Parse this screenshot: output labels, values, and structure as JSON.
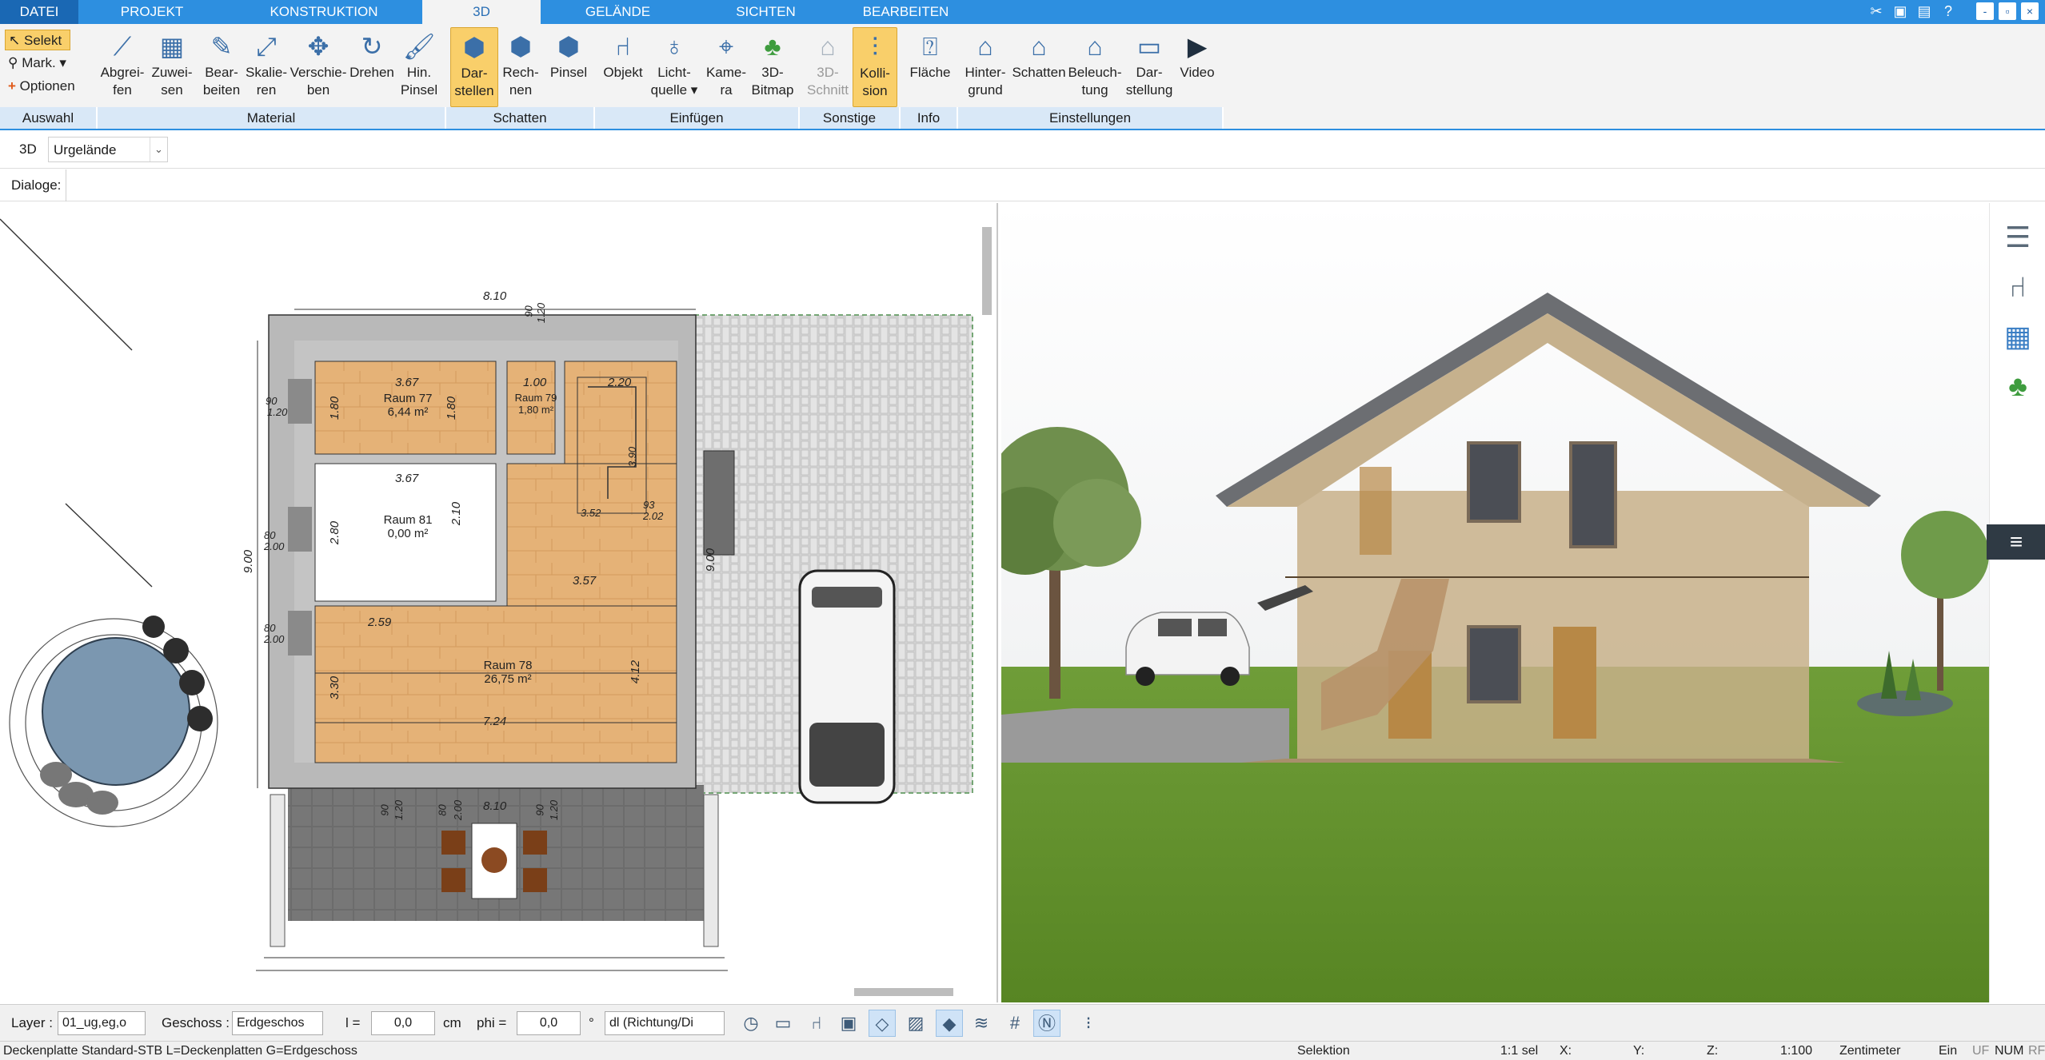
{
  "tabs": {
    "file": "DATEI",
    "items": [
      "PROJEKT",
      "KONSTRUKTION",
      "3D",
      "GELÄNDE",
      "SICHTEN",
      "BEARBEITEN"
    ],
    "active": "3D"
  },
  "window_controls": {
    "minimize": "-",
    "restore": "▫",
    "close": "×"
  },
  "ribbon": {
    "auswahl": {
      "select": "Selekt",
      "mark": "Mark.",
      "options": "Optionen",
      "group": "Auswahl"
    },
    "material": {
      "group": "Material",
      "buttons": [
        {
          "l1": "Abgrei-",
          "l2": "fen",
          "icon": "eyedropper-icon"
        },
        {
          "l1": "Zuwei-",
          "l2": "sen",
          "icon": "assign-icon"
        },
        {
          "l1": "Bear-",
          "l2": "beiten",
          "icon": "edit-material-icon"
        },
        {
          "l1": "Skalie-",
          "l2": "ren",
          "icon": "scale-icon"
        },
        {
          "l1": "Verschie-",
          "l2": "ben",
          "icon": "move-icon"
        },
        {
          "l1": "Drehen",
          "l2": "",
          "icon": "rotate-icon"
        },
        {
          "l1": "Hin.",
          "l2": "Pinsel",
          "icon": "brush-icon"
        }
      ]
    },
    "schatten": {
      "group": "Schatten",
      "buttons": [
        {
          "l1": "Dar-",
          "l2": "stellen",
          "icon": "shadow-display-icon",
          "active": true
        },
        {
          "l1": "Rech-",
          "l2": "nen",
          "icon": "shadow-calc-icon"
        },
        {
          "l1": "Pinsel",
          "l2": "",
          "icon": "shadow-brush-icon"
        }
      ]
    },
    "einfuegen": {
      "group": "Einfügen",
      "buttons": [
        {
          "l1": "Objekt",
          "l2": "",
          "icon": "chair-icon"
        },
        {
          "l1": "Licht-",
          "l2": "quelle ▾",
          "icon": "bulb-icon"
        },
        {
          "l1": "Kame-",
          "l2": "ra",
          "icon": "camera-icon"
        },
        {
          "l1": "3D-",
          "l2": "Bitmap",
          "icon": "tree-icon"
        }
      ]
    },
    "sonstige": {
      "group": "Sonstige",
      "buttons": [
        {
          "l1": "3D-",
          "l2": "Schnitt",
          "icon": "section-icon",
          "disabled": true
        },
        {
          "l1": "Kolli-",
          "l2": "sion",
          "icon": "collision-icon",
          "active": true
        }
      ]
    },
    "info": {
      "group": "Info",
      "buttons": [
        {
          "l1": "Fläche",
          "l2": "",
          "icon": "area-icon"
        }
      ]
    },
    "einstellungen": {
      "group": "Einstellungen",
      "buttons": [
        {
          "l1": "Hinter-",
          "l2": "grund",
          "icon": "background-icon"
        },
        {
          "l1": "Schatten",
          "l2": "",
          "icon": "house-shadow-icon"
        },
        {
          "l1": "Beleuch-",
          "l2": "tung",
          "icon": "house-light-icon"
        },
        {
          "l1": "Dar-",
          "l2": "stellung",
          "icon": "monitor-icon"
        },
        {
          "l1": "Video",
          "l2": "",
          "icon": "play-icon"
        }
      ]
    }
  },
  "row3d": {
    "label": "3D",
    "selection": "Urgelände"
  },
  "dialoge": {
    "label": "Dialoge:"
  },
  "plan": {
    "dims": {
      "top": "8.10",
      "bottom": "8.10",
      "left": "9.00",
      "mid_right": "9.00",
      "w_367a": "3.67",
      "w_367b": "3.67",
      "w_100": "1.00",
      "w_220": "2.20",
      "w_357": "3.57",
      "w_259": "2.59",
      "w_724": "7.24",
      "h_180a": "1.80",
      "h_180b": "1.80",
      "h_280": "2.80",
      "h_210": "2.10",
      "h_330": "3.30",
      "h_412": "4.12",
      "d_090a": "90",
      "d_120a": "1.20",
      "d_090b": "90",
      "d_120b": "1.20",
      "d_080a": "80",
      "d_200a": "2.00",
      "d_080b": "80",
      "d_200b": "2.00",
      "d_093": "93",
      "d_202": "2.02",
      "d_352": "3.52",
      "d_390": "3.90",
      "d_090c": "90",
      "d_120c": "1.20",
      "d_080c": "80",
      "d_200c": "2.00",
      "d_090d": "90",
      "d_120d": "1.20"
    },
    "rooms": [
      {
        "name": "Raum 77",
        "area": "6,44 m²"
      },
      {
        "name": "Raum 79",
        "area": "1,80 m²"
      },
      {
        "name": "Raum 81",
        "area": "0,00 m²"
      },
      {
        "name": "Raum 78",
        "area": "26,75 m²"
      }
    ]
  },
  "bottombar": {
    "layer_label": "Layer :",
    "layer_value": "01_ug,eg,o",
    "geschoss_label": "Geschoss :",
    "geschoss_value": "Erdgeschos",
    "l_label": "l =",
    "l_value": "0,0",
    "cm": "cm",
    "phi_label": "phi =",
    "phi_value": "0,0",
    "deg": "°",
    "dl_value": "dl (Richtung/Di"
  },
  "status": {
    "left": "Deckenplatte Standard-STB L=Deckenplatten G=Erdgeschoss",
    "mode": "Selektion",
    "sel": "1:1 sel",
    "x": "X:",
    "y": "Y:",
    "z": "Z:",
    "scale": "1:100",
    "unit": "Zentimeter",
    "ein": "Ein",
    "uf": "UF",
    "num": "NUM",
    "rf": "RF"
  },
  "colors": {
    "accent": "#2d8fe0",
    "ribbon": "#f3f3f3",
    "active_button": "#f9cf6a",
    "group_bar": "#d9e8f7"
  }
}
